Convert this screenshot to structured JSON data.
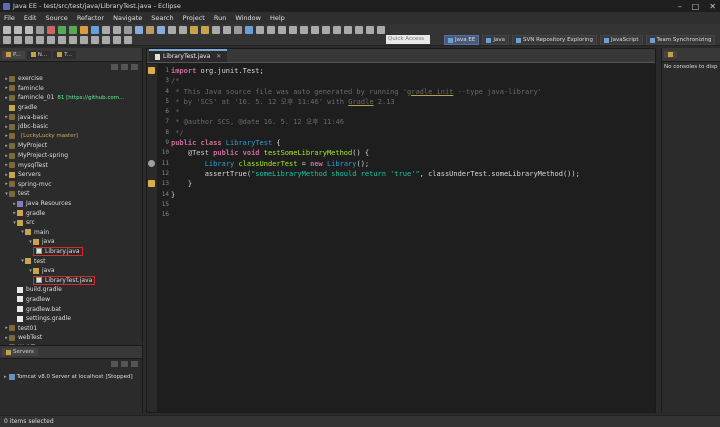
{
  "window": {
    "title": "Java EE - test/src/test/java/LibraryTest.java - Eclipse",
    "controls": [
      "–",
      "□",
      "✕"
    ]
  },
  "menu": [
    "File",
    "Edit",
    "Source",
    "Refactor",
    "Navigate",
    "Search",
    "Project",
    "Run",
    "Window",
    "Help"
  ],
  "toolbar": {
    "quick_access_placeholder": "Quick Access",
    "perspectives": [
      {
        "label": "Java EE",
        "active": true
      },
      {
        "label": "Java",
        "active": false
      },
      {
        "label": "SVN Repository Exploring",
        "active": false
      },
      {
        "label": "JavaScript",
        "active": false
      },
      {
        "label": "Team Synchronizing",
        "active": false
      }
    ]
  },
  "left_panel": {
    "tabs": [
      "P...",
      "N...",
      "T..."
    ],
    "tree": [
      {
        "label": "exercise",
        "depth": 0,
        "arrow": "▸",
        "icon": "project"
      },
      {
        "label": "famincle",
        "depth": 0,
        "arrow": "▸",
        "icon": "project"
      },
      {
        "label": "famincle_01",
        "depth": 0,
        "arrow": "▸",
        "icon": "project",
        "suffix": "81 [https://github.com..."
      },
      {
        "label": "gradle",
        "depth": 0,
        "arrow": "",
        "icon": "folder"
      },
      {
        "label": "java-basic",
        "depth": 0,
        "arrow": "▸",
        "icon": "project"
      },
      {
        "label": "jdbc-basic",
        "depth": 0,
        "arrow": "▸",
        "icon": "project"
      },
      {
        "label": "",
        "depth": 0,
        "arrow": "▸",
        "icon": "project",
        "suffix": "[LuckyLucky master]",
        "suffix_class": "gold"
      },
      {
        "label": "MyProject",
        "depth": 0,
        "arrow": "▸",
        "icon": "project"
      },
      {
        "label": "MyProject-spring",
        "depth": 0,
        "arrow": "▸",
        "icon": "project"
      },
      {
        "label": "mysqlTest",
        "depth": 0,
        "arrow": "▸",
        "icon": "project"
      },
      {
        "label": "Servers",
        "depth": 0,
        "arrow": "▸",
        "icon": "folder"
      },
      {
        "label": "spring-mvc",
        "depth": 0,
        "arrow": "▸",
        "icon": "project"
      },
      {
        "label": "test",
        "depth": 0,
        "arrow": "▾",
        "icon": "project"
      },
      {
        "label": "Java Resources",
        "depth": 1,
        "arrow": "▸",
        "icon": "lib"
      },
      {
        "label": "gradle",
        "depth": 1,
        "arrow": "▸",
        "icon": "folder"
      },
      {
        "label": "src",
        "depth": 1,
        "arrow": "▾",
        "icon": "folder"
      },
      {
        "label": "main",
        "depth": 2,
        "arrow": "▾",
        "icon": "folder"
      },
      {
        "label": "java",
        "depth": 3,
        "arrow": "▾",
        "icon": "folder"
      },
      {
        "label": "Library.java",
        "depth": 3,
        "arrow": "",
        "icon": "jfile",
        "highlight": true
      },
      {
        "label": "test",
        "depth": 2,
        "arrow": "▾",
        "icon": "folder"
      },
      {
        "label": "java",
        "depth": 3,
        "arrow": "▾",
        "icon": "folder"
      },
      {
        "label": "LibraryTest.java",
        "depth": 3,
        "arrow": "",
        "icon": "jfile",
        "highlight": true
      },
      {
        "label": "build.gradle",
        "depth": 1,
        "arrow": "",
        "icon": "file"
      },
      {
        "label": "gradlew",
        "depth": 1,
        "arrow": "",
        "icon": "file"
      },
      {
        "label": "gradlew.bat",
        "depth": 1,
        "arrow": "",
        "icon": "file"
      },
      {
        "label": "settings.gradle",
        "depth": 1,
        "arrow": "",
        "icon": "file"
      },
      {
        "label": "test01",
        "depth": 0,
        "arrow": "▸",
        "icon": "project"
      },
      {
        "label": "webTest",
        "depth": 0,
        "arrow": "▸",
        "icon": "project"
      },
      {
        "label": "WebToon",
        "depth": 0,
        "arrow": "▸",
        "icon": "project"
      }
    ]
  },
  "servers_panel": {
    "tab": "Servers",
    "row": "Tomcat v8.0 Server at localhost",
    "row_status": "[Stopped]"
  },
  "editor": {
    "tab": "LibraryTest.java",
    "line_numbers": [
      "1",
      "3",
      "4",
      "5",
      "6",
      "7",
      "8",
      "9",
      "10",
      "11",
      "12",
      "13",
      "14",
      "15",
      "16"
    ],
    "code": {
      "l1_kw": "import ",
      "l1_rest": "org.junit.Test;",
      "l3": "/*",
      "l4a": " * This Java source file was auto generated by running '",
      "l4b": "gradle init",
      "l4c": " --type java-library'",
      "l5a": " * by 'SCS' at '16. 5. 12 오후 11:46' with ",
      "l5b": "Gradle",
      "l5c": " 2.13",
      "l6": " *",
      "l7": " * @author SCS, @date 16. 5. 12 오후 11:46",
      "l8": " */",
      "l9_kw1": "public class ",
      "l9_cls": "LibraryTest",
      "l9_rest": " {",
      "l10_an": "    @Test ",
      "l10_kw": "public void ",
      "l10_fn": "testSomeLibraryMethod",
      "l10_rest": "() {",
      "l11_cls": "        Library ",
      "l11_var": "classUnderTest",
      "l11_eq": " = ",
      "l11_kw": "new ",
      "l11_cls2": "Library",
      "l11_rest": "();",
      "l12_a": "        assertTrue(",
      "l12_str": "\"someLibraryMethod should return 'true'\"",
      "l12_b": ", classUnderTest.someLibraryMethod());",
      "l13": "    }",
      "l14": "}",
      "l15": "",
      "l16": ""
    }
  },
  "right_panel": {
    "text": "No consoles to disp"
  },
  "status": {
    "text": "0 items selected"
  },
  "colors": {
    "highlight_box": "#d62a2a",
    "editor_bg": "#1e1e1e",
    "keyword": "#cc6c9c",
    "class": "#2e9bd6",
    "method": "#a7ec21",
    "string": "#17c6a3",
    "comment": "#6a6a6a"
  }
}
